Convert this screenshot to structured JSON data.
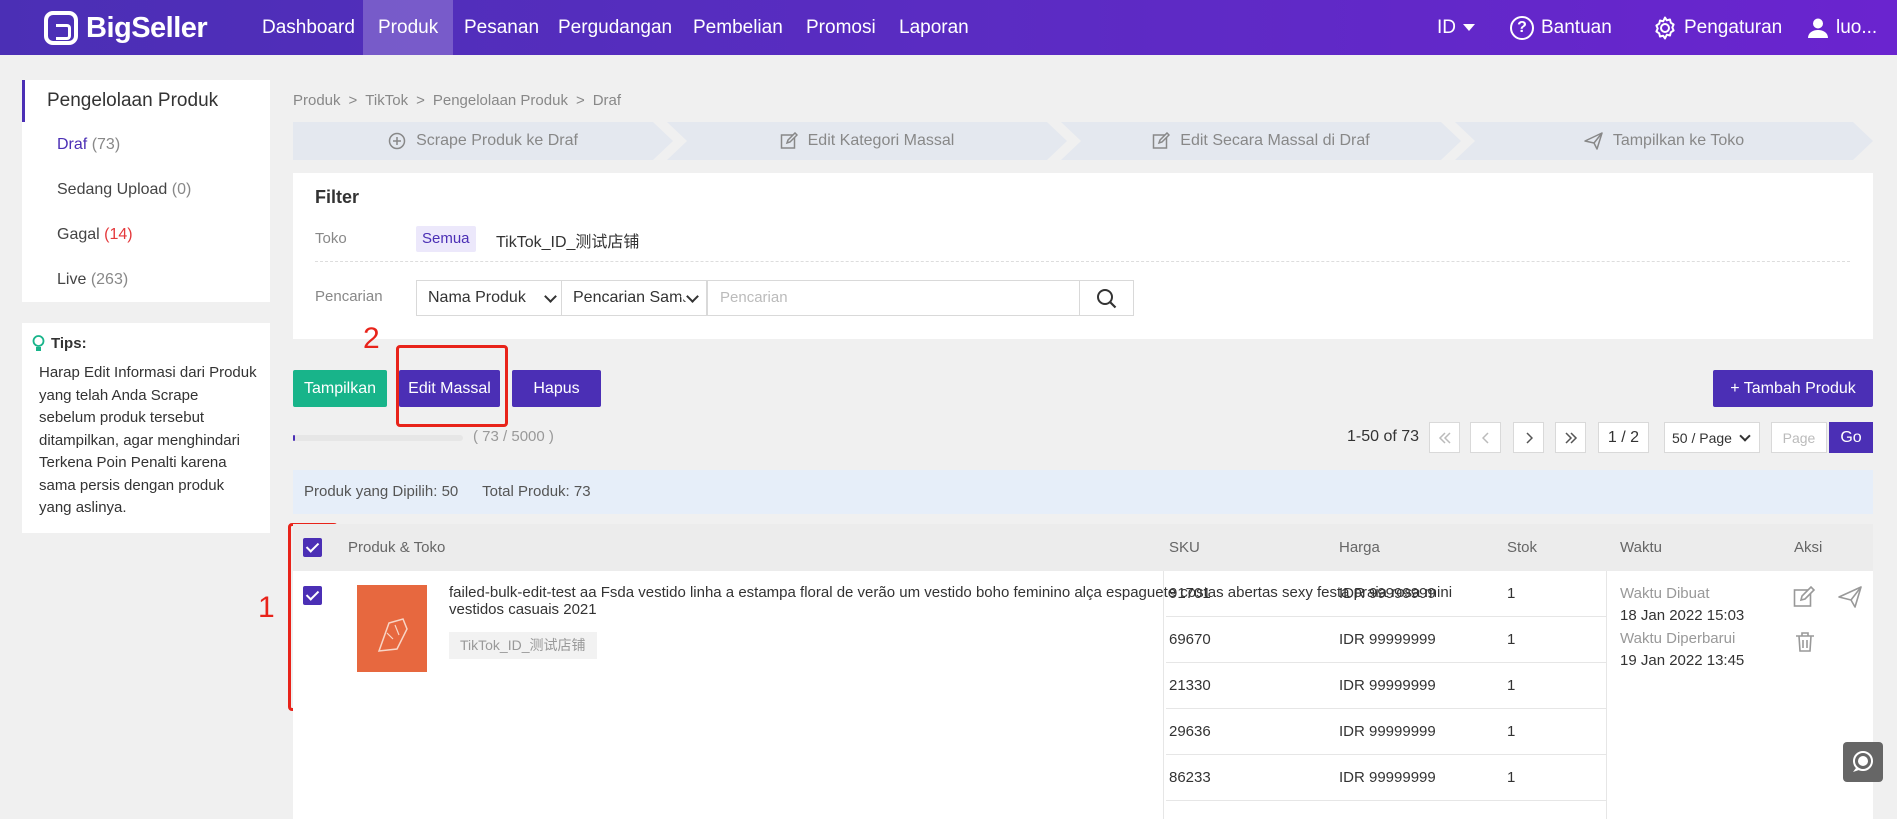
{
  "brand": {
    "name": "BigSeller"
  },
  "nav": {
    "items": [
      "Dashboard",
      "Produk",
      "Pesanan",
      "Pergudangan",
      "Pembelian",
      "Promosi",
      "Laporan"
    ],
    "active": "Produk",
    "lang": "ID",
    "help": "Bantuan",
    "settings": "Pengaturan",
    "user": "luo..."
  },
  "sidebar": {
    "title": "Pengelolaan Produk",
    "items": [
      {
        "label": "Draf",
        "count": "(73)"
      },
      {
        "label": "Sedang Upload",
        "count": "(0)"
      },
      {
        "label": "Gagal",
        "count": "(14)"
      },
      {
        "label": "Live",
        "count": "(263)"
      }
    ],
    "tips_title": "Tips:",
    "tips_body": "Harap Edit Informasi dari Produk yang telah Anda Scrape sebelum produk tersebut ditampilkan, agar menghindari Terkena Poin Penalti karena sama persis dengan produk yang aslinya."
  },
  "breadcrumb": [
    "Produk",
    "TikTok",
    "Pengelolaan Produk",
    "Draf"
  ],
  "steps": [
    "Scrape Produk ke Draf",
    "Edit Kategori Massal",
    "Edit Secara Massal di Draf",
    "Tampilkan ke Toko"
  ],
  "filter": {
    "title": "Filter",
    "store_label": "Toko",
    "store_all": "Semua",
    "store_name": "TikTok_ID_测试店铺",
    "search_label": "Pencarian",
    "field_select": "Nama Produk",
    "mode_select": "Pencarian Sama",
    "search_placeholder": "Pencarian"
  },
  "actions": {
    "show": "Tampilkan",
    "bulk_edit": "Edit Massal",
    "delete": "Hapus",
    "add": "+ Tambah Produk"
  },
  "annotations": {
    "one": "1",
    "two": "2"
  },
  "usage": {
    "text": "( 73 / 5000 )",
    "fraction": 0.0146
  },
  "pagination": {
    "info": "1-50 of 73",
    "page": "1 / 2",
    "per_page": "50 / Page",
    "page_placeholder": "Page",
    "go": "Go"
  },
  "selection": {
    "selected": "Produk yang Dipilih: 50",
    "total": "Total Produk: 73"
  },
  "table": {
    "headers": {
      "product": "Produk & Toko",
      "sku": "SKU",
      "price": "Harga",
      "stock": "Stok",
      "time": "Waktu",
      "action": "Aksi"
    },
    "row": {
      "name": "failed-bulk-edit-test aa Fsda vestido linha a estampa floral de verão um vestido boho feminino alça espaguete costas abertas sexy festa praia rosa mini vestidos casuais 2021",
      "shop": "TikTok_ID_测试店铺",
      "variants": [
        {
          "sku": "91701",
          "price": "IDR 99999999",
          "stock": "1"
        },
        {
          "sku": "69670",
          "price": "IDR 99999999",
          "stock": "1"
        },
        {
          "sku": "21330",
          "price": "IDR 99999999",
          "stock": "1"
        },
        {
          "sku": "29636",
          "price": "IDR 99999999",
          "stock": "1"
        },
        {
          "sku": "86233",
          "price": "IDR 99999999",
          "stock": "1"
        }
      ],
      "created_label": "Waktu Dibuat",
      "created": "18 Jan 2022 15:03",
      "updated_label": "Waktu Diperbarui",
      "updated": "19 Jan 2022 13:45"
    }
  },
  "colors": {
    "primary": "#4b2fb5",
    "green": "#18b48a",
    "annotation": "#e8231a"
  }
}
